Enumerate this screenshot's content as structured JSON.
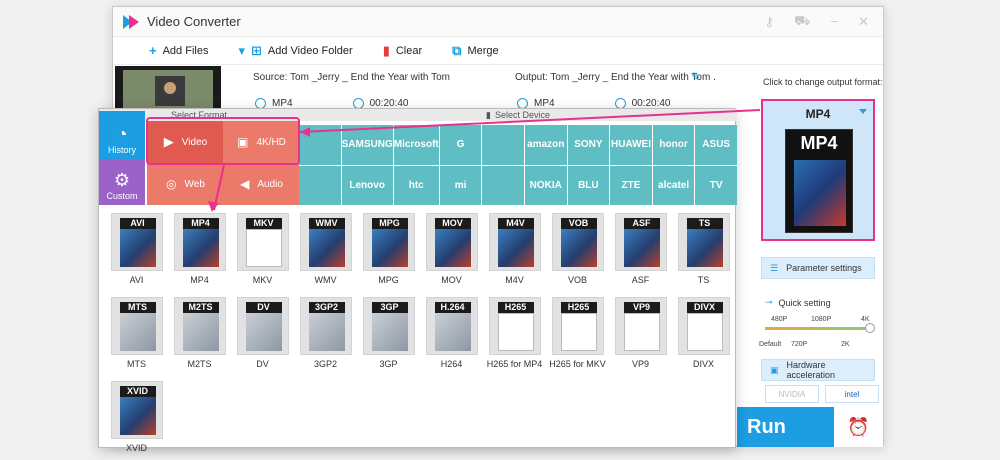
{
  "window": {
    "title": "Video Converter"
  },
  "toolbar": {
    "add_files": "Add Files",
    "add_folder": "Add Video Folder",
    "clear": "Clear",
    "merge": "Merge"
  },
  "file": {
    "source": "Source: Tom _Jerry _ End the Year with Tom and J...",
    "output": "Output: Tom _Jerry _ End the Year with Tom ...",
    "src_format": "MP4",
    "src_duration": "00:20:40",
    "out_format": "MP4",
    "out_duration": "00:20:40"
  },
  "right": {
    "click_label": "Click to change output format:",
    "format": "MP4",
    "param": "Parameter settings",
    "quick": "Quick setting",
    "q480": "480P",
    "q1080": "1080P",
    "q4k": "4K",
    "qdefault": "Default",
    "q720": "720P",
    "q2k": "2K",
    "hw": "Hardware acceleration",
    "nvidia": "NVIDIA",
    "intel": "intel",
    "run": "Run"
  },
  "popup": {
    "select_format": "Select Format",
    "select_device": "Select Device",
    "history": "History",
    "custom": "Custom",
    "video": "Video",
    "hd": "4K/HD",
    "web": "Web",
    "audio": "Audio",
    "devices": [
      "",
      "SAMSUNG",
      "Microsoft",
      "G",
      "",
      "amazon",
      "SONY",
      "HUAWEI",
      "honor",
      "ASUS",
      "",
      "Lenovo",
      "htc",
      "mi",
      "",
      "NOKIA",
      "BLU",
      "ZTE",
      "alcatel",
      "TV"
    ],
    "formats": [
      {
        "badge": "AVI",
        "label": "AVI",
        "style": ""
      },
      {
        "badge": "MP4",
        "label": "MP4",
        "style": ""
      },
      {
        "badge": "MKV",
        "label": "MKV",
        "style": "white"
      },
      {
        "badge": "WMV",
        "label": "WMV",
        "style": ""
      },
      {
        "badge": "MPG",
        "label": "MPG",
        "style": ""
      },
      {
        "badge": "MOV",
        "label": "MOV",
        "style": ""
      },
      {
        "badge": "M4V",
        "label": "M4V",
        "style": ""
      },
      {
        "badge": "VOB",
        "label": "VOB",
        "style": ""
      },
      {
        "badge": "ASF",
        "label": "ASF",
        "style": ""
      },
      {
        "badge": "TS",
        "label": "TS",
        "style": ""
      },
      {
        "badge": "MTS",
        "label": "MTS",
        "style": "gray"
      },
      {
        "badge": "M2TS",
        "label": "M2TS",
        "style": "gray"
      },
      {
        "badge": "DV",
        "label": "DV",
        "style": "gray"
      },
      {
        "badge": "3GP2",
        "label": "3GP2",
        "style": "gray"
      },
      {
        "badge": "3GP",
        "label": "3GP",
        "style": "gray"
      },
      {
        "badge": "H.264",
        "label": "H264",
        "style": "gray"
      },
      {
        "badge": "H265",
        "label": "H265 for MP4",
        "style": "white"
      },
      {
        "badge": "H265",
        "label": "H265 for MKV",
        "style": "white"
      },
      {
        "badge": "VP9",
        "label": "VP9",
        "style": "white"
      },
      {
        "badge": "DIVX",
        "label": "DIVX",
        "style": "white"
      },
      {
        "badge": "XVID",
        "label": "XVID",
        "style": ""
      }
    ]
  },
  "colors": {
    "accent": "#1d9ee3",
    "highlight": "#e8318c",
    "device": "#5fbdc4",
    "video": "#e8605a"
  }
}
